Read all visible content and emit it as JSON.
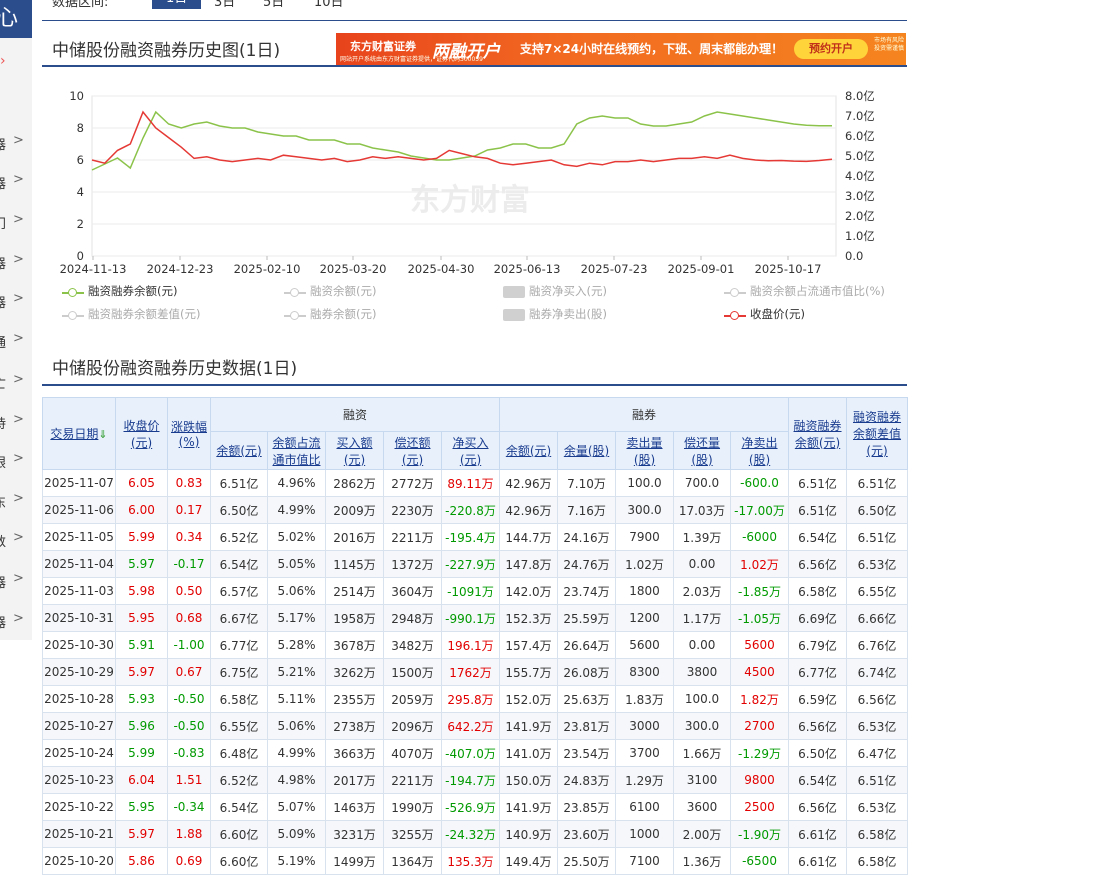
{
  "left_nav": {
    "top_text": "心",
    "items": [
      {
        "label": "器",
        "chev": ">"
      },
      {
        "label": "器",
        "chev": ">"
      },
      {
        "label": "门",
        "chev": ">"
      },
      {
        "label": "器",
        "chev": ">"
      },
      {
        "label": "器",
        "chev": ">"
      },
      {
        "label": "通",
        "chev": ">"
      },
      {
        "label": "亡",
        "chev": ">"
      },
      {
        "label": "持",
        "chev": ">"
      },
      {
        "label": "眼",
        "chev": ">"
      },
      {
        "label": "东",
        "chev": ">"
      },
      {
        "label": "数",
        "chev": ">"
      },
      {
        "label": "器",
        "chev": ">"
      },
      {
        "label": "器",
        "chev": ">"
      }
    ]
  },
  "range": {
    "label": "数据区间:",
    "tabs": [
      "1日",
      "3日",
      "5日",
      "10日"
    ],
    "active": 0
  },
  "chart_section": {
    "title": "中储股份融资融券历史图(1日)"
  },
  "ad": {
    "brand": "东方财富证券",
    "brand_sub": "Eastmoney Securities",
    "small": "网站开户系统由东方财富证券提供，证券代码300059",
    "headline": "两融开户",
    "desc": "支持7×24小时在线预约，下班、周末都能办理！",
    "button": "预约开户",
    "risk": "市场有风险 投资需谨慎"
  },
  "chart_data": {
    "type": "line",
    "watermark": "东方财富",
    "x_ticks": [
      "2024-11-13",
      "2024-12-23",
      "2025-02-10",
      "2025-03-20",
      "2025-04-30",
      "2025-06-13",
      "2025-07-23",
      "2025-09-01",
      "2025-10-17"
    ],
    "y_left": {
      "ticks": [
        "0",
        "2",
        "4",
        "6",
        "8",
        "10"
      ],
      "range": [
        0,
        10
      ]
    },
    "y_right": {
      "ticks": [
        "0.0",
        "1.0亿",
        "2.0亿",
        "3.0亿",
        "4.0亿",
        "5.0亿",
        "6.0亿",
        "7.0亿",
        "8.0亿"
      ],
      "range": [
        0,
        8
      ],
      "unit": "亿"
    },
    "series": [
      {
        "name": "融资融券余额(元)",
        "axis": "right",
        "color": "#8bc34a",
        "values": [
          4.3,
          4.6,
          4.9,
          4.4,
          5.9,
          7.2,
          6.6,
          6.4,
          6.6,
          6.7,
          6.5,
          6.4,
          6.4,
          6.2,
          6.1,
          6.0,
          6.0,
          5.8,
          5.8,
          5.8,
          5.6,
          5.6,
          5.4,
          5.3,
          5.2,
          5.0,
          4.9,
          4.8,
          4.8,
          4.9,
          5.0,
          5.3,
          5.4,
          5.6,
          5.6,
          5.4,
          5.4,
          5.6,
          6.6,
          6.9,
          7.0,
          6.9,
          6.9,
          6.6,
          6.5,
          6.5,
          6.6,
          6.7,
          7.0,
          7.2,
          7.1,
          7.0,
          6.9,
          6.8,
          6.7,
          6.6,
          6.54,
          6.51,
          6.51
        ]
      },
      {
        "name": "收盘价(元)",
        "axis": "left",
        "color": "#e53935",
        "values": [
          6.0,
          5.8,
          6.6,
          7.0,
          9.0,
          8.0,
          7.4,
          6.8,
          6.1,
          6.2,
          6.0,
          5.9,
          6.0,
          6.1,
          6.0,
          6.3,
          6.2,
          6.1,
          6.0,
          6.1,
          5.9,
          6.0,
          6.2,
          6.1,
          6.2,
          6.1,
          6.0,
          6.1,
          6.6,
          6.4,
          6.2,
          6.1,
          5.8,
          5.7,
          5.8,
          5.9,
          6.0,
          5.7,
          5.6,
          5.8,
          5.7,
          5.9,
          5.9,
          6.0,
          5.9,
          6.0,
          6.1,
          6.1,
          6.2,
          6.1,
          6.3,
          6.1,
          6.0,
          5.95,
          5.97,
          5.93,
          5.91,
          5.97,
          6.05
        ]
      }
    ],
    "legend": [
      {
        "label": "融资融券余额(元)",
        "type": "line",
        "color": "#8bc34a",
        "active": true
      },
      {
        "label": "融资余额(元)",
        "type": "line",
        "color": "#cccccc",
        "active": false
      },
      {
        "label": "融资净买入(元)",
        "type": "box",
        "color": "#d0d0d0",
        "active": false
      },
      {
        "label": "融资余额占流通市值比(%)",
        "type": "line",
        "color": "#cccccc",
        "active": false
      },
      {
        "label": "融资融券余额差值(元)",
        "type": "line",
        "color": "#cccccc",
        "active": false
      },
      {
        "label": "融券余额(元)",
        "type": "line",
        "color": "#cccccc",
        "active": false
      },
      {
        "label": "融券净卖出(股)",
        "type": "box",
        "color": "#d0d0d0",
        "active": false
      },
      {
        "label": "收盘价(元)",
        "type": "line",
        "color": "#e53935",
        "active": true
      }
    ]
  },
  "table_section": {
    "title": "中储股份融资融券历史数据(1日)"
  },
  "table": {
    "headers": {
      "date": "交易日期",
      "close": "收盘价\n(元)",
      "chg": "涨跌幅\n(%)",
      "rz_group": "融资",
      "rq_group": "融券",
      "rz_bal": "余额(元)",
      "rz_ratio": "余额占流\n通市值比",
      "rz_buy": "买入额\n(元)",
      "rz_repay": "偿还额\n(元)",
      "rz_net": "净买入\n(元)",
      "rq_bal": "余额(元)",
      "rq_qty": "余量(股)",
      "rq_sell": "卖出量\n(股)",
      "rq_repay": "偿还量\n(股)",
      "rq_net": "净卖出\n(股)",
      "total": "融资融券\n余额(元)",
      "diff": "融资融券\n余额差值\n(元)"
    },
    "rows": [
      [
        "2025-11-07",
        "6.05",
        "0.83",
        "6.51亿",
        "4.96%",
        "2862万",
        "2772万",
        "89.11万",
        "42.96万",
        "7.10万",
        "100.0",
        "700.0",
        "-600.0",
        "6.51亿",
        "6.51亿"
      ],
      [
        "2025-11-06",
        "6.00",
        "0.17",
        "6.50亿",
        "4.99%",
        "2009万",
        "2230万",
        "-220.8万",
        "42.96万",
        "7.16万",
        "300.0",
        "17.03万",
        "-17.00万",
        "6.51亿",
        "6.50亿"
      ],
      [
        "2025-11-05",
        "5.99",
        "0.34",
        "6.52亿",
        "5.02%",
        "2016万",
        "2211万",
        "-195.4万",
        "144.7万",
        "24.16万",
        "7900",
        "1.39万",
        "-6000",
        "6.54亿",
        "6.51亿"
      ],
      [
        "2025-11-04",
        "5.97",
        "-0.17",
        "6.54亿",
        "5.05%",
        "1145万",
        "1372万",
        "-227.9万",
        "147.8万",
        "24.76万",
        "1.02万",
        "0.00",
        "1.02万",
        "6.56亿",
        "6.53亿"
      ],
      [
        "2025-11-03",
        "5.98",
        "0.50",
        "6.57亿",
        "5.06%",
        "2514万",
        "3604万",
        "-1091万",
        "142.0万",
        "23.74万",
        "1800",
        "2.03万",
        "-1.85万",
        "6.58亿",
        "6.55亿"
      ],
      [
        "2025-10-31",
        "5.95",
        "0.68",
        "6.67亿",
        "5.17%",
        "1958万",
        "2948万",
        "-990.1万",
        "152.3万",
        "25.59万",
        "1200",
        "1.17万",
        "-1.05万",
        "6.69亿",
        "6.66亿"
      ],
      [
        "2025-10-30",
        "5.91",
        "-1.00",
        "6.77亿",
        "5.28%",
        "3678万",
        "3482万",
        "196.1万",
        "157.4万",
        "26.64万",
        "5600",
        "0.00",
        "5600",
        "6.79亿",
        "6.76亿"
      ],
      [
        "2025-10-29",
        "5.97",
        "0.67",
        "6.75亿",
        "5.21%",
        "3262万",
        "1500万",
        "1762万",
        "155.7万",
        "26.08万",
        "8300",
        "3800",
        "4500",
        "6.77亿",
        "6.74亿"
      ],
      [
        "2025-10-28",
        "5.93",
        "-0.50",
        "6.58亿",
        "5.11%",
        "2355万",
        "2059万",
        "295.8万",
        "152.0万",
        "25.63万",
        "1.83万",
        "100.0",
        "1.82万",
        "6.59亿",
        "6.56亿"
      ],
      [
        "2025-10-27",
        "5.96",
        "-0.50",
        "6.55亿",
        "5.06%",
        "2738万",
        "2096万",
        "642.2万",
        "141.9万",
        "23.81万",
        "3000",
        "300.0",
        "2700",
        "6.56亿",
        "6.53亿"
      ],
      [
        "2025-10-24",
        "5.99",
        "-0.83",
        "6.48亿",
        "4.99%",
        "3663万",
        "4070万",
        "-407.0万",
        "141.0万",
        "23.54万",
        "3700",
        "1.66万",
        "-1.29万",
        "6.50亿",
        "6.47亿"
      ],
      [
        "2025-10-23",
        "6.04",
        "1.51",
        "6.52亿",
        "4.98%",
        "2017万",
        "2211万",
        "-194.7万",
        "150.0万",
        "24.83万",
        "1.29万",
        "3100",
        "9800",
        "6.54亿",
        "6.51亿"
      ],
      [
        "2025-10-22",
        "5.95",
        "-0.34",
        "6.54亿",
        "5.07%",
        "1463万",
        "1990万",
        "-526.9万",
        "141.9万",
        "23.85万",
        "6100",
        "3600",
        "2500",
        "6.56亿",
        "6.53亿"
      ],
      [
        "2025-10-21",
        "5.97",
        "1.88",
        "6.60亿",
        "5.09%",
        "3231万",
        "3255万",
        "-24.32万",
        "140.9万",
        "23.60万",
        "1000",
        "2.00万",
        "-1.90万",
        "6.61亿",
        "6.58亿"
      ],
      [
        "2025-10-20",
        "5.86",
        "0.69",
        "6.60亿",
        "5.19%",
        "1499万",
        "1364万",
        "135.3万",
        "149.4万",
        "25.50万",
        "7100",
        "1.36万",
        "-6500",
        "6.61亿",
        "6.58亿"
      ]
    ]
  }
}
